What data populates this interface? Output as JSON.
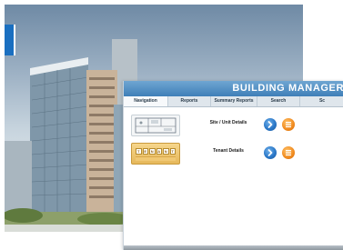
{
  "app": {
    "title": "BUILDING MANAGER",
    "tabs": [
      {
        "label": "Navigation",
        "active": true
      },
      {
        "label": "Reports",
        "active": false
      },
      {
        "label": "Summary Reports",
        "active": false
      },
      {
        "label": "Search",
        "active": false
      },
      {
        "label": "Sc",
        "active": false
      }
    ],
    "rows": [
      {
        "label": "Site / Unit Details",
        "thumbnail": "floor-plan"
      },
      {
        "label": "Tenant Details",
        "thumbnail": "tenant-sign",
        "sign_letters": [
          "T",
          "E",
          "N",
          "A",
          "N",
          "T"
        ]
      }
    ],
    "icons": {
      "go": "chevron-right-icon",
      "list": "list-icon"
    },
    "colors": {
      "title_bar": "#3f7fb8",
      "go_button": "#2b78c8",
      "list_button": "#f08a1e",
      "tenant_sign": "#e6b85a"
    }
  }
}
